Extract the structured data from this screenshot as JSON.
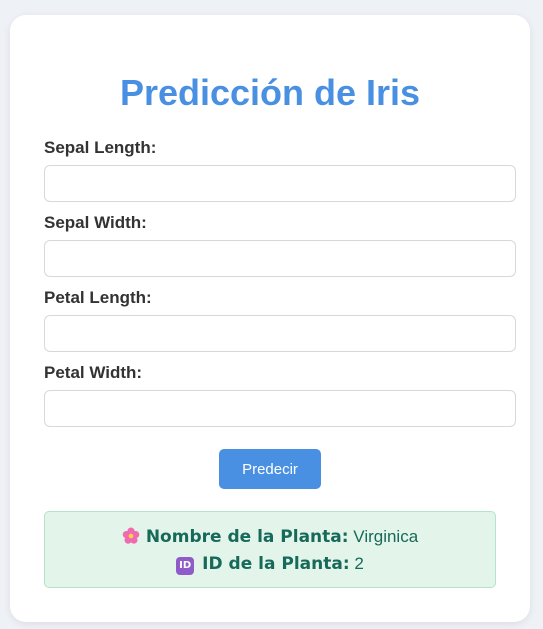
{
  "form": {
    "title": "Predicción de Iris",
    "fields": [
      {
        "label": "Sepal Length:",
        "value": "",
        "placeholder": ""
      },
      {
        "label": "Sepal Width:",
        "value": "",
        "placeholder": ""
      },
      {
        "label": "Petal Length:",
        "value": "",
        "placeholder": ""
      },
      {
        "label": "Petal Width:",
        "value": "",
        "placeholder": ""
      }
    ],
    "submit_label": "Predecir"
  },
  "result": {
    "name_label": "Nombre de la Planta:",
    "name_value": "Virginica",
    "id_label": "ID de la Planta:",
    "id_value": "2",
    "name_icon": "flower-icon",
    "id_icon": "id-icon",
    "id_icon_text": "ID"
  },
  "colors": {
    "accent": "#4a90e2",
    "result_background": "#e3f5ea",
    "result_text": "#17695a",
    "page_background": "#eef1f6"
  }
}
